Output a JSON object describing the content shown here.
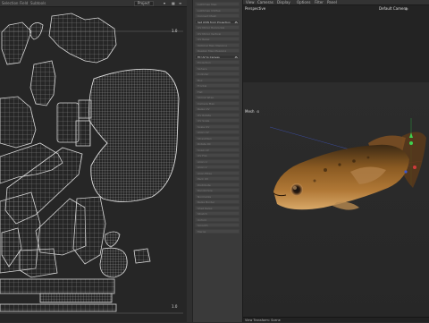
{
  "uv_editor": {
    "menu": [
      "Selection",
      "Field",
      "Subtools"
    ],
    "project_select": "Project",
    "corner_top_right": "1.0",
    "corner_bottom_right": "1.0"
  },
  "operations_panel": {
    "items": [
      "Lightmap Map",
      "Lightmap UVMap",
      "Connect Mesh",
      "Set UVW from Projection",
      "UV Mirror Horizontal",
      "UV Mirror Vertical",
      "UV Relax",
      "Optimal Map Mapping",
      "Realign Map Mapping",
      "Fit UV to Canvas",
      "Projection",
      "Sphere",
      "Cylinder",
      "Box",
      "Frontal",
      "Flat",
      "Shrink Wrap",
      "Camera Map",
      "Relax UV",
      "UV Rotate",
      "UV Scale",
      "Scale UV",
      "Align UV",
      "Straighten",
      "Rotate 90",
      "Snap UV",
      "UV Flip",
      "Align U",
      "Align V",
      "Align Edge",
      "Pack UV",
      "Distribute",
      "Randomize",
      "Normalize",
      "Relax Border",
      "Shell Relax",
      "Stretch",
      "Unfold",
      "Smooth",
      "Merge"
    ],
    "active_items": [
      3,
      9
    ]
  },
  "viewport": {
    "menu": [
      "View",
      "Cameras",
      "Display",
      "Options",
      "Filter",
      "Panel"
    ],
    "view_label": "Perspective",
    "camera_label": "Default Camera",
    "mesh_label": "Mesh",
    "status_text": "View Transform: Scene"
  }
}
